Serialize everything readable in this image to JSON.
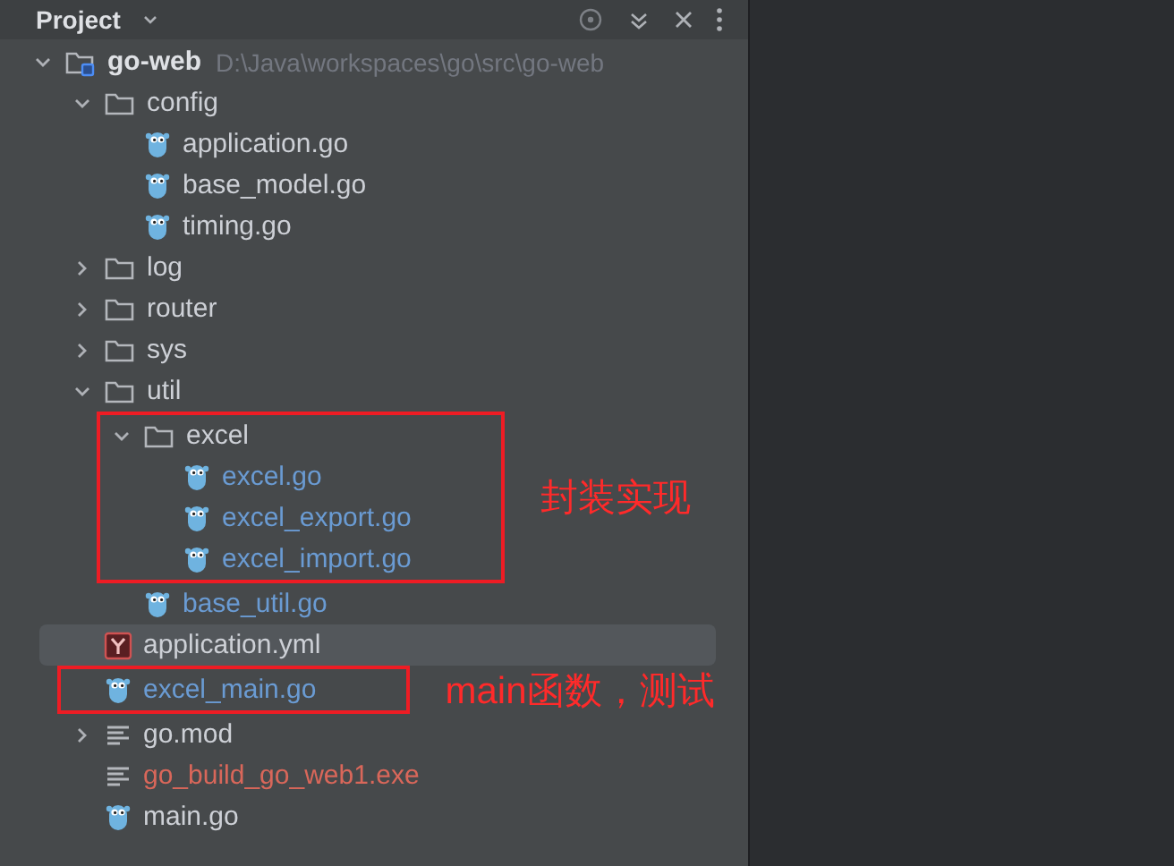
{
  "panel": {
    "title": "Project"
  },
  "tree": [
    {
      "name": "go-web",
      "kind": "project",
      "path": "D:\\Java\\workspaces\\go\\src\\go-web",
      "expanded": true,
      "selected": false,
      "color": "#dfe1e5",
      "children": [
        {
          "name": "config",
          "kind": "folder",
          "expanded": true,
          "selected": false,
          "color": "#cdd0d6",
          "children": [
            {
              "name": "application.go",
              "kind": "go",
              "selected": false,
              "color": "#cdd0d6"
            },
            {
              "name": "base_model.go",
              "kind": "go",
              "selected": false,
              "color": "#cdd0d6"
            },
            {
              "name": "timing.go",
              "kind": "go",
              "selected": false,
              "color": "#cdd0d6"
            }
          ]
        },
        {
          "name": "log",
          "kind": "folder",
          "expanded": false,
          "selected": false,
          "color": "#cdd0d6"
        },
        {
          "name": "router",
          "kind": "folder",
          "expanded": false,
          "selected": false,
          "color": "#cdd0d6"
        },
        {
          "name": "sys",
          "kind": "folder",
          "expanded": false,
          "selected": false,
          "color": "#cdd0d6"
        },
        {
          "name": "util",
          "kind": "folder",
          "expanded": true,
          "selected": false,
          "color": "#cdd0d6",
          "children": [
            {
              "name": "excel",
              "kind": "folder",
              "expanded": true,
              "selected": false,
              "color": "#cdd0d6",
              "annotation": "封装实现",
              "children": [
                {
                  "name": "excel.go",
                  "kind": "go",
                  "selected": false,
                  "color": "#6a9bd3"
                },
                {
                  "name": "excel_export.go",
                  "kind": "go",
                  "selected": false,
                  "color": "#6a9bd3"
                },
                {
                  "name": "excel_import.go",
                  "kind": "go",
                  "selected": false,
                  "color": "#6a9bd3"
                }
              ]
            },
            {
              "name": "base_util.go",
              "kind": "go",
              "selected": false,
              "color": "#6a9bd3"
            }
          ]
        },
        {
          "name": "application.yml",
          "kind": "yaml",
          "selected": true,
          "color": "#cdd0d6"
        },
        {
          "name": "excel_main.go",
          "kind": "go",
          "selected": false,
          "color": "#6a9bd3",
          "annotation": "main函数，测试"
        },
        {
          "name": "go.mod",
          "kind": "text",
          "expanded": false,
          "selected": false,
          "color": "#cdd0d6"
        },
        {
          "name": "go_build_go_web1.exe",
          "kind": "text",
          "selected": false,
          "color": "#d9675a"
        },
        {
          "name": "main.go",
          "kind": "go",
          "selected": false,
          "color": "#cdd0d6"
        }
      ]
    }
  ]
}
